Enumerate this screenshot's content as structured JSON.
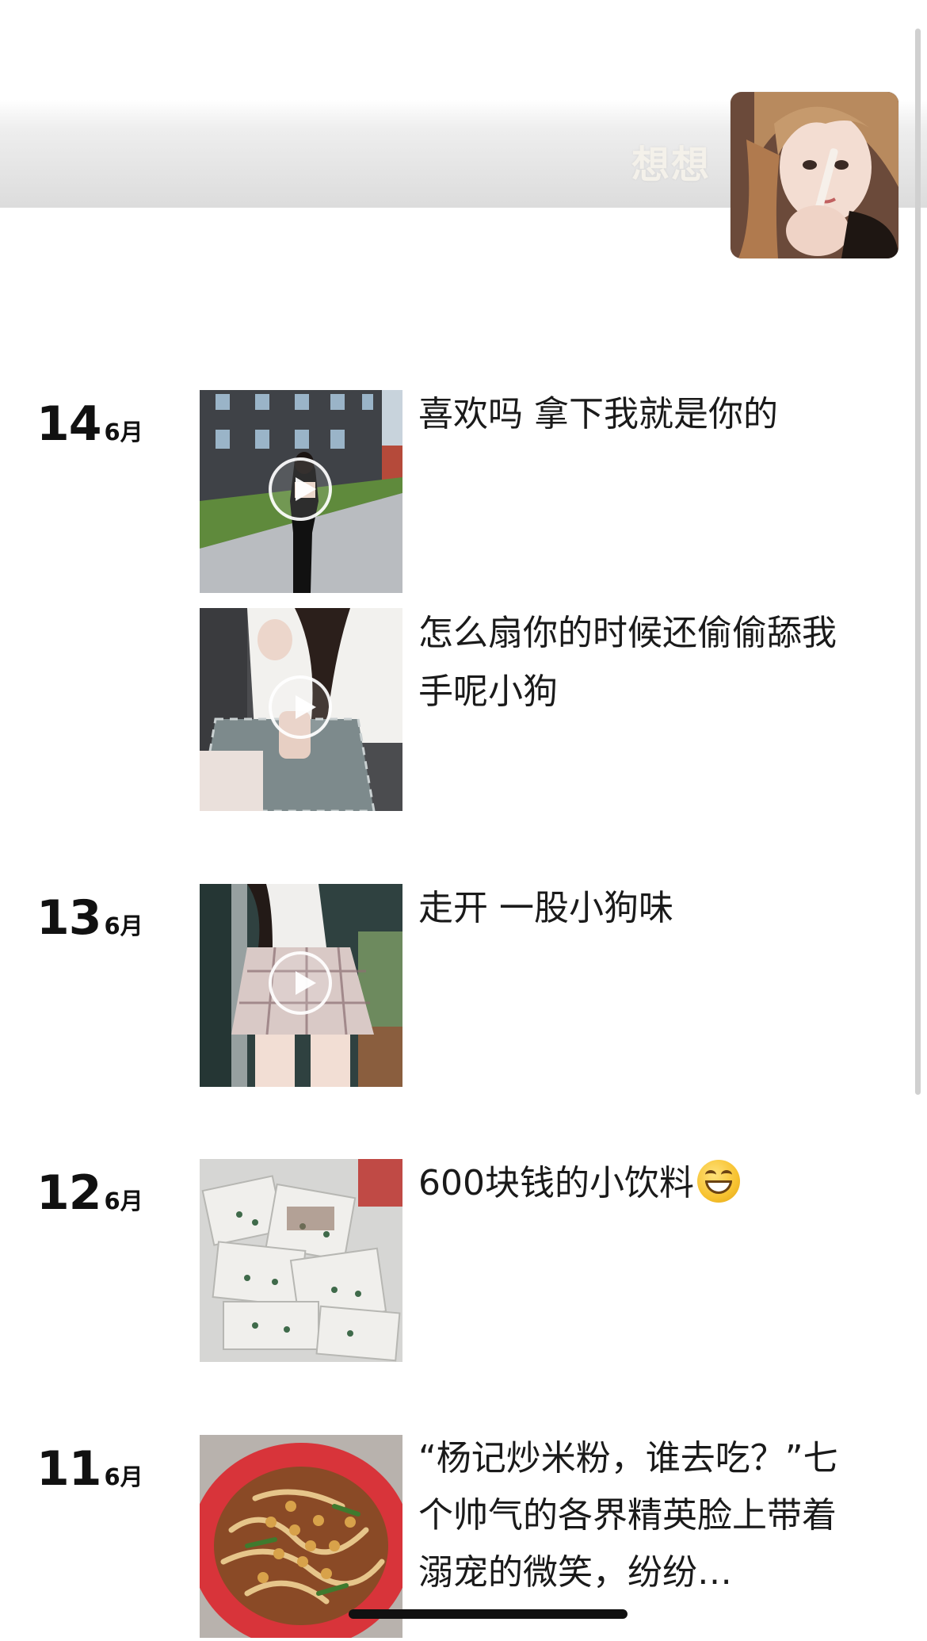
{
  "profile": {
    "nickname": "想想",
    "avatar_icon": "profile-avatar-photo"
  },
  "posts": [
    {
      "date_day": "14",
      "date_month": "6月",
      "items": [
        {
          "caption": "喜欢吗 拿下我就是你的",
          "media": "video",
          "thumb": "woman-walking-outdoor-video-thumbnail"
        },
        {
          "caption": "怎么扇你的时候还偷偷舔我手呢小狗",
          "media": "video",
          "thumb": "school-uniform-video-thumbnail"
        }
      ]
    },
    {
      "date_day": "13",
      "date_month": "6月",
      "items": [
        {
          "caption": "走开 一股小狗味",
          "media": "video",
          "thumb": "plaid-skirt-video-thumbnail"
        }
      ]
    },
    {
      "date_day": "12",
      "date_month": "6月",
      "items": [
        {
          "caption": "600块钱的小饮料",
          "emoji": "grinning-face-emoji",
          "media": "photo",
          "thumb": "drink-bags-photo-thumbnail"
        }
      ]
    },
    {
      "date_day": "11",
      "date_month": "6月",
      "items": [
        {
          "caption": "“杨记炒米粉，谁去吃？”七个帅气的各界精英脸上带着溺宠的微笑，纷纷…",
          "media": "photo",
          "thumb": "fried-rice-noodles-photo-thumbnail"
        }
      ]
    }
  ],
  "colors": {
    "text": "#1a1a1a",
    "date_text": "#111111",
    "nickname_text": "#f4f1ea",
    "scrollbar": "#d0d0d0"
  }
}
